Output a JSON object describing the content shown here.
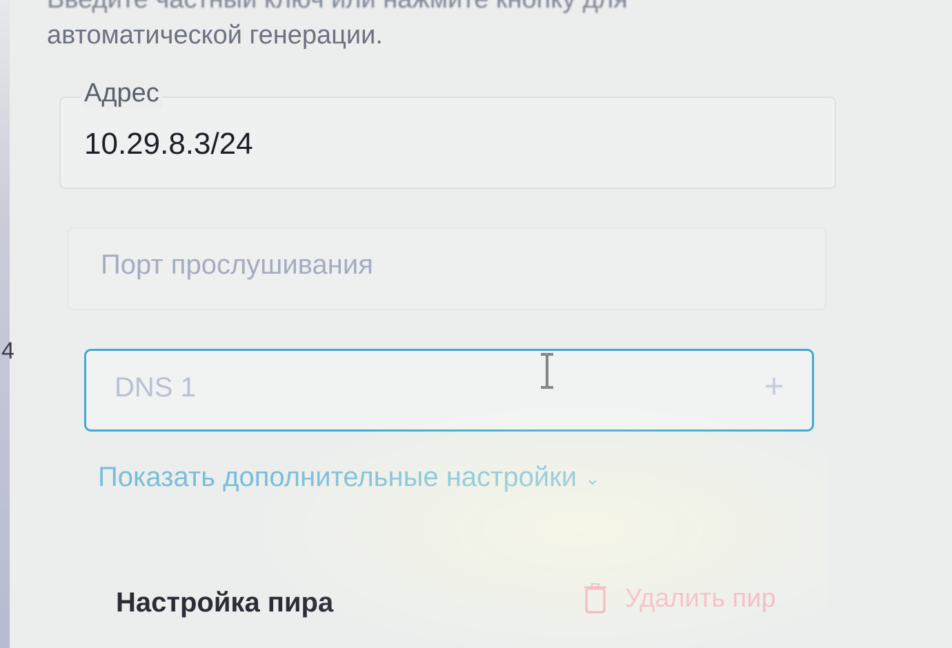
{
  "description": {
    "partial_line": "Введите частный ключ или нажмите кнопку для",
    "line": "автоматической генерации."
  },
  "address": {
    "label": "Адрес",
    "value": "10.29.8.3/24"
  },
  "listen_port": {
    "placeholder": "Порт прослушивания"
  },
  "dns": {
    "placeholder": "DNS 1",
    "add_icon": "plus-icon"
  },
  "advanced_link": {
    "label": "Показать дополнительные настройки",
    "icon": "chevron-down-icon"
  },
  "peer": {
    "title": "Настройка пира",
    "delete_label": "Удалить пир",
    "delete_icon": "trash-icon"
  },
  "stray_text": "4",
  "colors": {
    "accent": "#41a9cf",
    "link": "#79bdd8",
    "danger": "#f3b8c4",
    "placeholder": "#a3acc0"
  }
}
